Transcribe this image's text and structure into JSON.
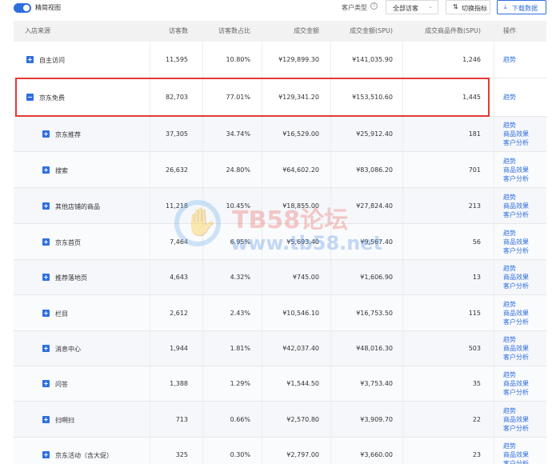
{
  "toolbar": {
    "simple_view_label": "精简视图",
    "customer_type_label": "客户类型",
    "customer_type_value": "全部访客",
    "switch_indicator_label": "切换指标",
    "download_label": "下载数据"
  },
  "table": {
    "headers": [
      "入店来源",
      "访客数",
      "访客数占比",
      "成交金额",
      "成交金额(SPU)",
      "成交商品件数(SPU)",
      "操作"
    ],
    "rows": [
      {
        "source": "自主访问",
        "visitors": "11,595",
        "ratio": "10.80%",
        "amount": "¥129,899.30",
        "amount_spu": "¥141,035.90",
        "items_spu": "1,246",
        "actions": [
          "趋势"
        ]
      },
      {
        "source": "京东免费",
        "visitors": "82,703",
        "ratio": "77.01%",
        "amount": "¥129,341.20",
        "amount_spu": "¥153,510.60",
        "items_spu": "1,445",
        "actions": [
          "趋势"
        ]
      },
      {
        "source": "京东推荐",
        "visitors": "37,305",
        "ratio": "34.74%",
        "amount": "¥16,529.00",
        "amount_spu": "¥25,912.40",
        "items_spu": "181",
        "actions": [
          "趋势",
          "商品效果",
          "客户分析"
        ]
      },
      {
        "source": "搜索",
        "visitors": "26,632",
        "ratio": "24.80%",
        "amount": "¥64,602.20",
        "amount_spu": "¥83,086.20",
        "items_spu": "701",
        "actions": [
          "趋势",
          "商品效果",
          "客户分析"
        ]
      },
      {
        "source": "其他店铺的商品",
        "visitors": "11,218",
        "ratio": "10.45%",
        "amount": "¥18,855.00",
        "amount_spu": "¥27,824.40",
        "items_spu": "213",
        "actions": [
          "趋势",
          "商品效果",
          "客户分析"
        ]
      },
      {
        "source": "京东首页",
        "visitors": "7,464",
        "ratio": "6.95%",
        "amount": "¥5,693.40",
        "amount_spu": "¥9,567.40",
        "items_spu": "56",
        "actions": [
          "趋势",
          "商品效果",
          "客户分析"
        ]
      },
      {
        "source": "推荐落地页",
        "visitors": "4,643",
        "ratio": "4.32%",
        "amount": "¥745.00",
        "amount_spu": "¥1,606.90",
        "items_spu": "13",
        "actions": [
          "趋势",
          "商品效果",
          "客户分析"
        ]
      },
      {
        "source": "栏目",
        "visitors": "2,612",
        "ratio": "2.43%",
        "amount": "¥10,546.10",
        "amount_spu": "¥16,753.50",
        "items_spu": "115",
        "actions": [
          "趋势",
          "商品效果",
          "客户分析"
        ]
      },
      {
        "source": "消息中心",
        "visitors": "1,944",
        "ratio": "1.81%",
        "amount": "¥42,037.40",
        "amount_spu": "¥48,016.30",
        "items_spu": "503",
        "actions": [
          "趋势",
          "商品效果",
          "客户分析"
        ]
      },
      {
        "source": "问答",
        "visitors": "1,388",
        "ratio": "1.29%",
        "amount": "¥1,544.50",
        "amount_spu": "¥3,753.40",
        "items_spu": "35",
        "actions": [
          "趋势",
          "商品效果",
          "客户分析"
        ]
      },
      {
        "source": "扫啊扫",
        "visitors": "713",
        "ratio": "0.66%",
        "amount": "¥2,570.80",
        "amount_spu": "¥3,909.70",
        "items_spu": "22",
        "actions": [
          "趋势",
          "商品效果",
          "客户分析"
        ]
      },
      {
        "source": "京东活动（含大促）",
        "visitors": "325",
        "ratio": "0.30%",
        "amount": "¥2,797.00",
        "amount_spu": "¥3,660.00",
        "items_spu": "23",
        "actions": [
          "趋势",
          "商品效果",
          "客户分析"
        ]
      }
    ]
  },
  "watermark": {
    "line1": "TB58论坛",
    "line2": "www.tb58.net"
  },
  "colors": {
    "accent": "#2e6fe0",
    "highlight": "#e53935"
  }
}
